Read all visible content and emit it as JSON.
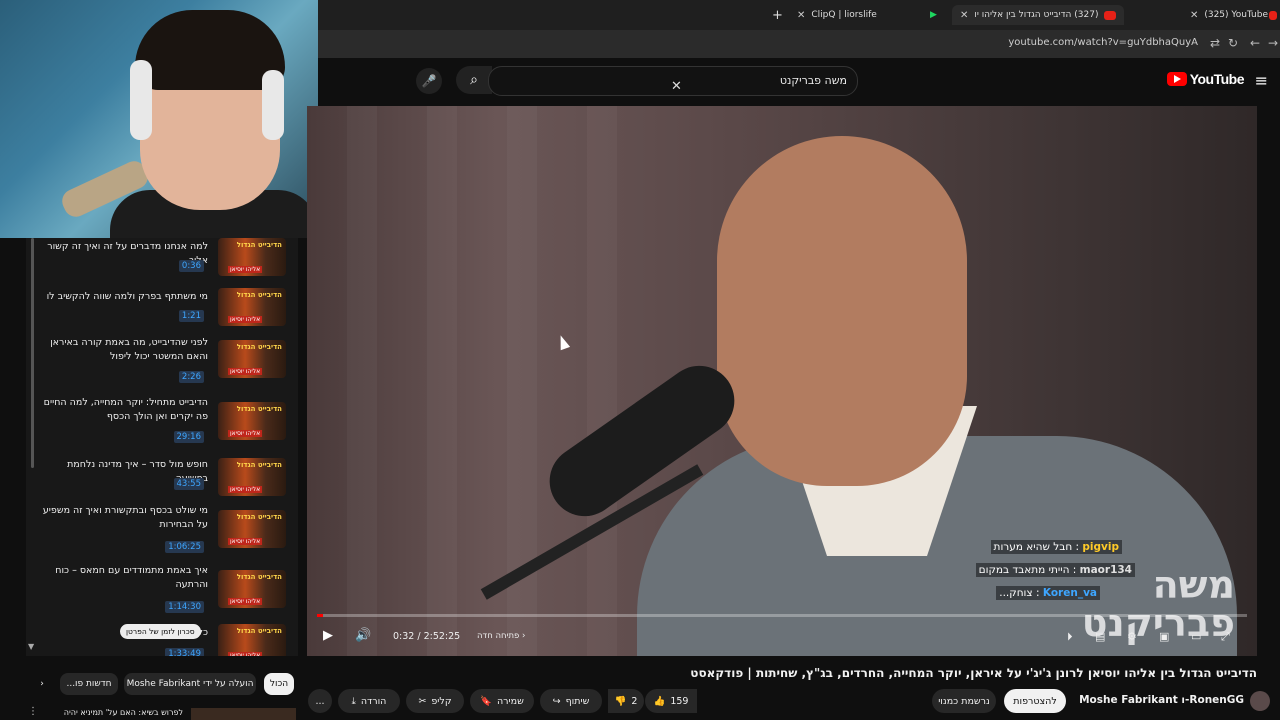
{
  "browser": {
    "tabs": [
      {
        "label": "(325) YouTube"
      },
      {
        "label": "(327) הדיבייט הגדול בין אליהו יו"
      },
      {
        "label": "ClipQ | liorslife"
      }
    ],
    "url": "youtube.com/watch?v=guYdbhaQuyA"
  },
  "youtube": {
    "logo": "YouTube",
    "search_query": "משה פבריקנט"
  },
  "chapters": [
    {
      "title": "למה אנחנו מדברים על זה ואיך זה קשור אליך",
      "time": "0:36",
      "thumb": "הדיבייט הגדול"
    },
    {
      "title": "מי משתתף בפרק ולמה שווה להקשיב לו",
      "time": "1:21",
      "thumb": "הדיבייט הגדול"
    },
    {
      "title": "לפני שהדיבייט, מה באמת קורה באיראן והאם המשטר יכול ליפול",
      "time": "2:26",
      "thumb": "הדיבייט הגדול"
    },
    {
      "title": "הדיבייט מתחיל: יוקר המחייה, למה החיים פה יקרים ואן הולך הכסף",
      "time": "29:16",
      "thumb": "הדיבייט הגדול"
    },
    {
      "title": "חופש מול סדר – איך מדינה נלחמת בפשיעה",
      "time": "43:55",
      "thumb": "הדיבייט הגדול"
    },
    {
      "title": "מי שולט בכסף ובתקשורת ואיך זה משפיע על הבחירות",
      "time": "1:06:25",
      "thumb": "הדיבייט הגדול"
    },
    {
      "title": "איך באמת מתמודדים עם חמאס – כוח והרתעה",
      "time": "1:14:30",
      "thumb": "הדיבייט הגדול"
    },
    {
      "title": "כל מה לא",
      "time": "1:33:49",
      "thumb": "הדיבייט הגדול"
    }
  ],
  "chapter_tooltip": "סכרון לזמן של הפרטן",
  "player": {
    "time_display": "0:32 / 2:52:25",
    "chapter_label": "פתיחה חדה",
    "progress_fraction": 0.002,
    "watermark_line1": "משה",
    "watermark_line2": "פבריקנט"
  },
  "chat": [
    {
      "user": "pigvip",
      "text": "חבל שהיא מערות",
      "color": "#ffca28"
    },
    {
      "user": "maor134",
      "text": "הייתי מתאבד במקום",
      "color": "#e0e0e0"
    },
    {
      "user": "Koren_va",
      "text": "צוחק...",
      "color": "#3ea6ff"
    }
  ],
  "video": {
    "title": "הדיבייט הגדול בין אליהו יוסיאן לרונן ג'יג'י על איראן, יוקר המחייה, החרדים, בג\"ץ, שחיתות | פודקאסט",
    "channel": "RonenGG-ו Moshe Fabrikant",
    "join_label": "להצטרפות",
    "subscribed_label": "נרשמת כמנוי",
    "likes": "159",
    "dislikes": "2",
    "share_label": "שיתוף",
    "save_label": "שמירה",
    "clip_label": "קליפ",
    "download_label": "הורדה",
    "more_label": "..."
  },
  "filters": {
    "all": "הכול",
    "uploaded_by": "הועלה על ידי Moshe Fabrikant",
    "new": "חדשות פו..."
  },
  "bottom_item": "לפרוש בשיא: האם על' תמיניא יהיה"
}
